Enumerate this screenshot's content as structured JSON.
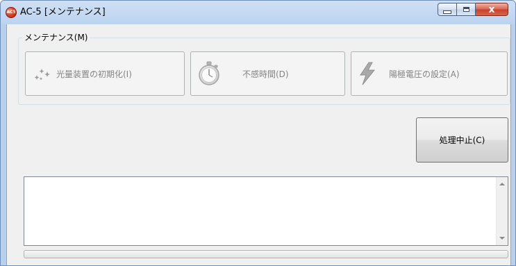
{
  "window": {
    "title": "AC-5 [メンテナンス]",
    "app_icon_text": "AC5",
    "close_glyph": "x"
  },
  "maintenance_group": {
    "label": "メンテナンス(M)",
    "buttons": [
      {
        "label": "光量装置の初期化(I)",
        "icon": "sparkle-icon",
        "enabled": false
      },
      {
        "label": "不感時間(D)",
        "icon": "stopwatch-icon",
        "enabled": false
      },
      {
        "label": "陽極電圧の設定(A)",
        "icon": "lightning-bolt-icon",
        "enabled": false
      }
    ]
  },
  "stop_button": {
    "label": "処理中止(C)",
    "enabled": true
  },
  "log": {
    "text": ""
  },
  "progress": {
    "value": 0
  },
  "colors": {
    "disabled_text": "#838383",
    "progress_green": "#37b44a"
  }
}
